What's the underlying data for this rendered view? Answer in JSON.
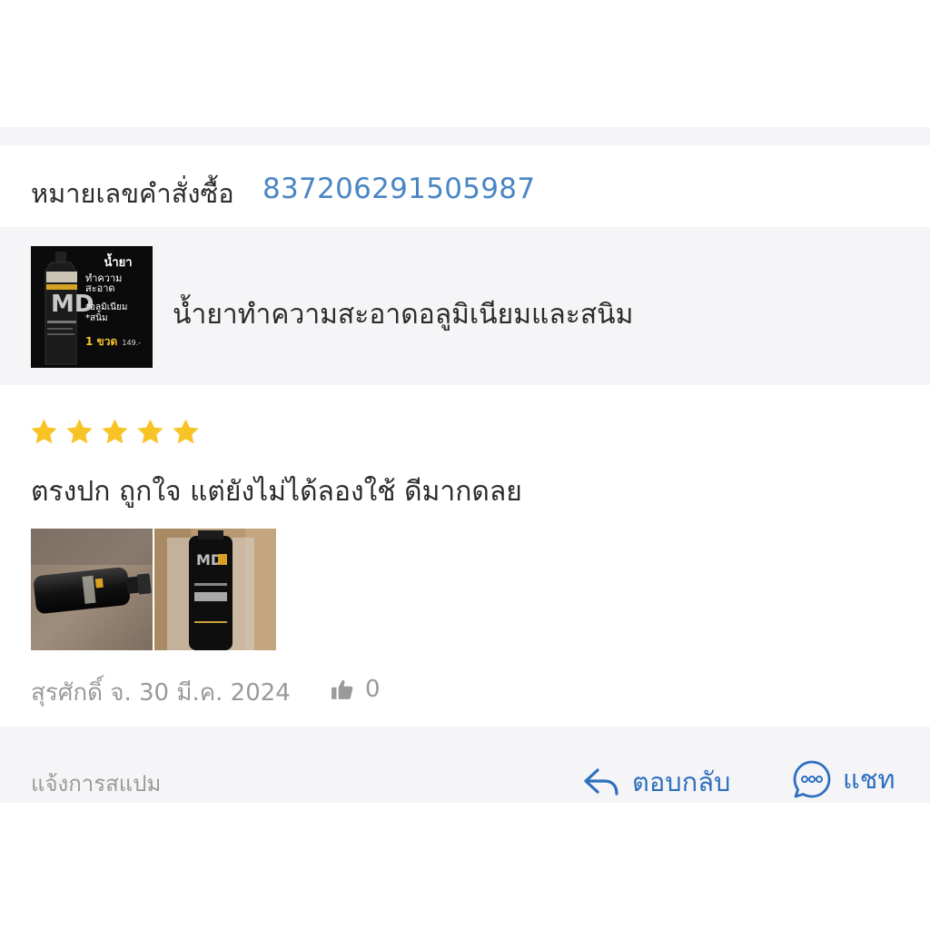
{
  "order": {
    "label": "หมายเลขคำสั่งซื้อ",
    "number": "837206291505987"
  },
  "product": {
    "name": "น้ำยาทำความสะอาดอลูมิเนียมและสนิม",
    "thumbnail_lines": [
      "น้ำยา",
      "ทำความสะอาด",
      "*อลูมิเนียม",
      "*สนิม",
      "1 ขวด"
    ],
    "thumbnail_price": "149.-"
  },
  "review": {
    "rating": 5,
    "rating_max": 5,
    "text": "ตรงปก ถูกใจ  แต่ยังไม่ได้ลองใช้ ดีมากดลย",
    "author_date": "สุรศักดิ์ จ. 30 มี.ค. 2024",
    "likes": "0"
  },
  "footer": {
    "report_label": "แจ้งการสแปม",
    "reply_label": "ตอบกลับ",
    "chat_label": "แชท"
  },
  "colors": {
    "accent": "#2f6fbf",
    "order_number": "#4a86c4",
    "star": "#f7c325",
    "muted_text": "#9a9a9a",
    "band": "#f5f5f7"
  }
}
